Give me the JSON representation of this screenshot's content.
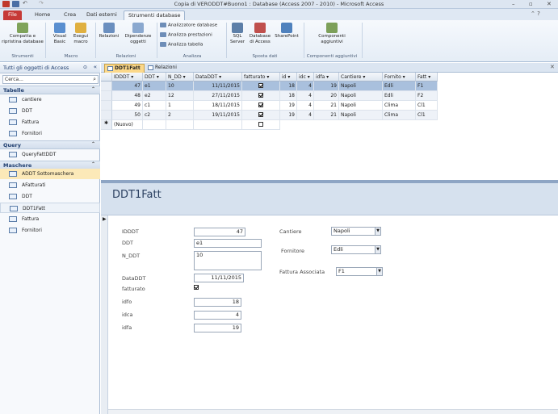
{
  "window": {
    "title": "Copia di VERODDT#Buono1 : Database (Access 2007 - 2010) - Microsoft Access"
  },
  "ribbon_tabs": [
    "File",
    "Home",
    "Crea",
    "Dati esterni",
    "Strumenti database"
  ],
  "ribbon": {
    "groups": [
      {
        "name": "Strumenti",
        "buttons": [
          "Compatta e ripristina database"
        ]
      },
      {
        "name": "Macro",
        "buttons": [
          "Visual Basic",
          "Esegui macro"
        ]
      },
      {
        "name": "Relazioni",
        "buttons": [
          "Relazioni",
          "Dipendenze oggetti"
        ]
      },
      {
        "name": "Analizza",
        "items": [
          "Analizzatore database",
          "Analizza prestazioni",
          "Analizza tabella"
        ]
      },
      {
        "name": "Sposta dati",
        "buttons": [
          "SQL Server",
          "Database di Access",
          "SharePoint"
        ]
      },
      {
        "name": "Componenti aggiuntivi",
        "buttons": [
          "Componenti aggiuntivi"
        ]
      }
    ]
  },
  "nav": {
    "header": "Tutti gli oggetti di Access",
    "search_placeholder": "Cerca...",
    "sections": [
      {
        "title": "Tabelle",
        "items": [
          "cantiere",
          "DDT",
          "Fattura",
          "Fornitori"
        ]
      },
      {
        "title": "Query",
        "items": [
          "QueryFattDDT"
        ]
      },
      {
        "title": "Maschere",
        "items": [
          "ADDT Sottomaschera",
          "AFatturati",
          "DDT",
          "DDT1Fatt",
          "Fattura",
          "Fornitori"
        ]
      }
    ]
  },
  "doc_tabs": [
    "DDT1Fatt",
    "Relazioni"
  ],
  "datasheet": {
    "columns": [
      "IDDDT",
      "DDT",
      "N_DD",
      "DataDDT",
      "fatturato",
      "id",
      "idc",
      "idfa",
      "Cantiere",
      "Fornito",
      "Fatt"
    ],
    "rows": [
      [
        "47",
        "e1",
        "10",
        "11/11/2015",
        "true",
        "18",
        "4",
        "19",
        "Napoli",
        "Edli",
        "F1"
      ],
      [
        "48",
        "e2",
        "12",
        "27/11/2015",
        "true",
        "18",
        "4",
        "20",
        "Napoli",
        "Edli",
        "F2"
      ],
      [
        "49",
        "c1",
        "1",
        "18/11/2015",
        "true",
        "19",
        "4",
        "21",
        "Napoli",
        "Clima",
        "Cl1"
      ],
      [
        "50",
        "c2",
        "2",
        "19/11/2015",
        "true",
        "19",
        "4",
        "21",
        "Napoli",
        "Clima",
        "Cl1"
      ]
    ],
    "new_row_label": "(Nuovo)"
  },
  "form": {
    "title": "DDT1Fatt",
    "labels": {
      "idddt": "IDDDT",
      "ddt": "DDT",
      "n_ddt": "N_DDT",
      "dataddt": "DataDDT",
      "fatturato": "fatturato",
      "idfo": "idfo",
      "idca": "idca",
      "idfa": "idfa",
      "cantiere": "Cantiere",
      "fornitore": "Fornitore",
      "fattura": "Fattura Associata"
    },
    "values": {
      "idddt": "47",
      "ddt": "e1",
      "n_ddt": "10",
      "dataddt": "11/11/2015",
      "fatturato": "true",
      "idfo": "18",
      "idca": "4",
      "idfa": "19",
      "cantiere": "Napoli",
      "fornitore": "Edli",
      "fattura": "F1"
    }
  },
  "colors": {
    "file_tab": "#c63a37",
    "selected_row": "#a9c0dd",
    "active_doc_tab": "#fbd88a",
    "form_header": "#d6e1ee"
  }
}
